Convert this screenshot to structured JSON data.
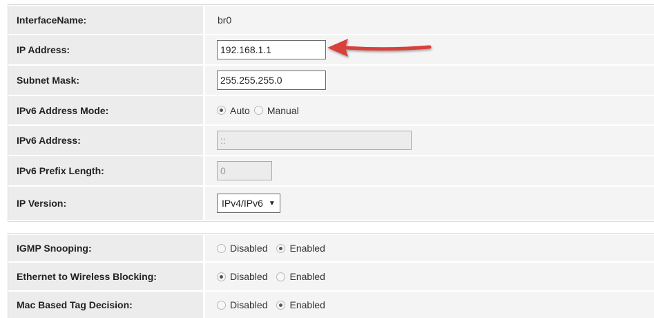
{
  "lan": {
    "interface_name": {
      "label": "InterfaceName:",
      "value": "br0"
    },
    "ip_address": {
      "label": "IP Address:",
      "value": "192.168.1.1"
    },
    "subnet_mask": {
      "label": "Subnet Mask:",
      "value": "255.255.255.0"
    },
    "ipv6_address_mode": {
      "label": "IPv6 Address Mode:",
      "options": [
        "Auto",
        "Manual"
      ],
      "selected": "Auto"
    },
    "ipv6_address": {
      "label": "IPv6 Address:",
      "value": "::"
    },
    "ipv6_prefix_length": {
      "label": "IPv6 Prefix Length:",
      "value": "0"
    },
    "ip_version": {
      "label": "IP Version:",
      "value": "IPv4/IPv6"
    }
  },
  "options": {
    "igmp_snooping": {
      "label": "IGMP Snooping:",
      "options": [
        "Disabled",
        "Enabled"
      ],
      "selected": "Enabled"
    },
    "eth_wireless_blocking": {
      "label": "Ethernet to Wireless Blocking:",
      "options": [
        "Disabled",
        "Enabled"
      ],
      "selected": "Disabled"
    },
    "mac_tag_decision": {
      "label": "Mac Based Tag Decision:",
      "options": [
        "Disabled",
        "Enabled"
      ],
      "selected": "Enabled"
    }
  },
  "annotation": {
    "arrow_color": "#d9403a"
  }
}
